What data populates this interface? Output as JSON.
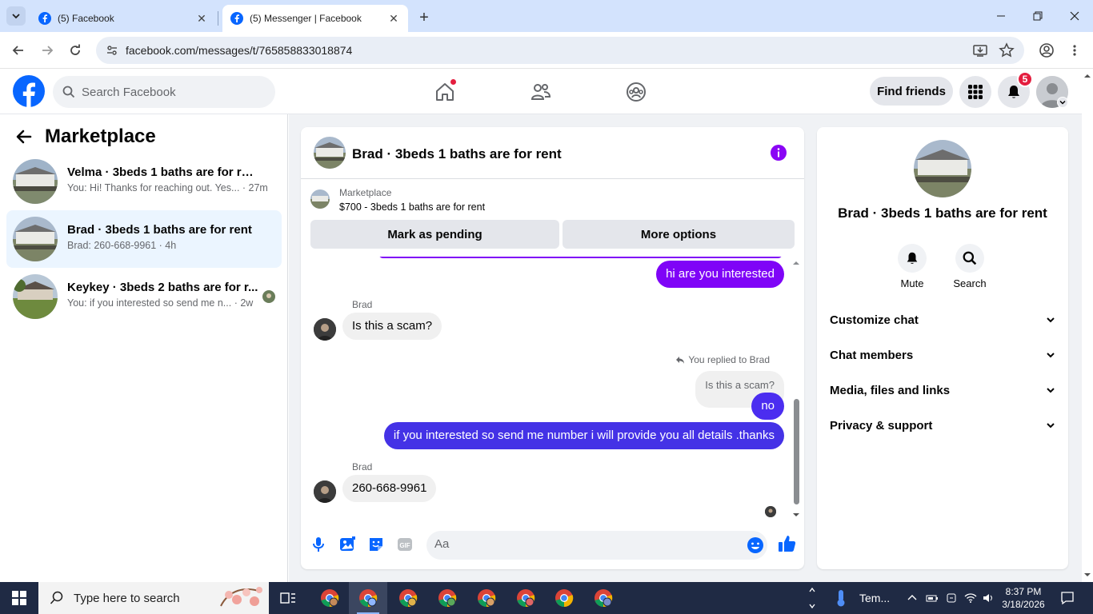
{
  "browser": {
    "tabs": [
      {
        "title": "(5) Facebook",
        "active": false
      },
      {
        "title": "(5) Messenger | Facebook",
        "active": true
      }
    ],
    "url": "facebook.com/messages/t/765858833018874"
  },
  "fb": {
    "search_placeholder": "Search Facebook",
    "find_friends": "Find friends",
    "notification_count": "5"
  },
  "sidebar": {
    "title": "Marketplace",
    "conversations": [
      {
        "name": "Velma · 3beds 1 baths are for rent",
        "snippet": "You: Hi! Thanks for reaching out. Yes... · 27m"
      },
      {
        "name": "Brad · 3beds 1 baths are for rent",
        "snippet": "Brad: 260-668-9961 · 4h",
        "selected": true
      },
      {
        "name": "Keykey · 3beds 2 baths are for r...",
        "snippet": "You: if you interested so send me n... · 2w"
      }
    ]
  },
  "chat": {
    "title": "Brad · 3beds 1 baths are for rent",
    "marketplace_label": "Marketplace",
    "listing": "$700 - 3beds 1 baths are for rent",
    "mark_pending": "Mark as pending",
    "more_options": "More options",
    "messages": {
      "m1": "hi are you interested",
      "sender1": "Brad",
      "m2": "Is this a scam?",
      "replied_to": "You replied to Brad",
      "quoted": "Is this a scam?",
      "m3": "no",
      "m4": "if you interested so send me number i will provide you all details .thanks",
      "sender2": "Brad",
      "m5": "260-668-9961"
    },
    "composer_placeholder": "Aa"
  },
  "info_panel": {
    "title": "Brad · 3beds 1 baths are for rent",
    "mute": "Mute",
    "search": "Search",
    "sections": [
      "Customize chat",
      "Chat members",
      "Media, files and links",
      "Privacy & support"
    ]
  },
  "taskbar": {
    "search_text": "Type here to search",
    "weather": "Tem...",
    "time": "8:37 PM",
    "date": "3/18/2026"
  },
  "colors": {
    "fb_blue": "#0866ff",
    "outgoing_purple": "#7f04f7",
    "outgoing_blue": "#4432e6",
    "badge_red": "#e41e3f"
  }
}
